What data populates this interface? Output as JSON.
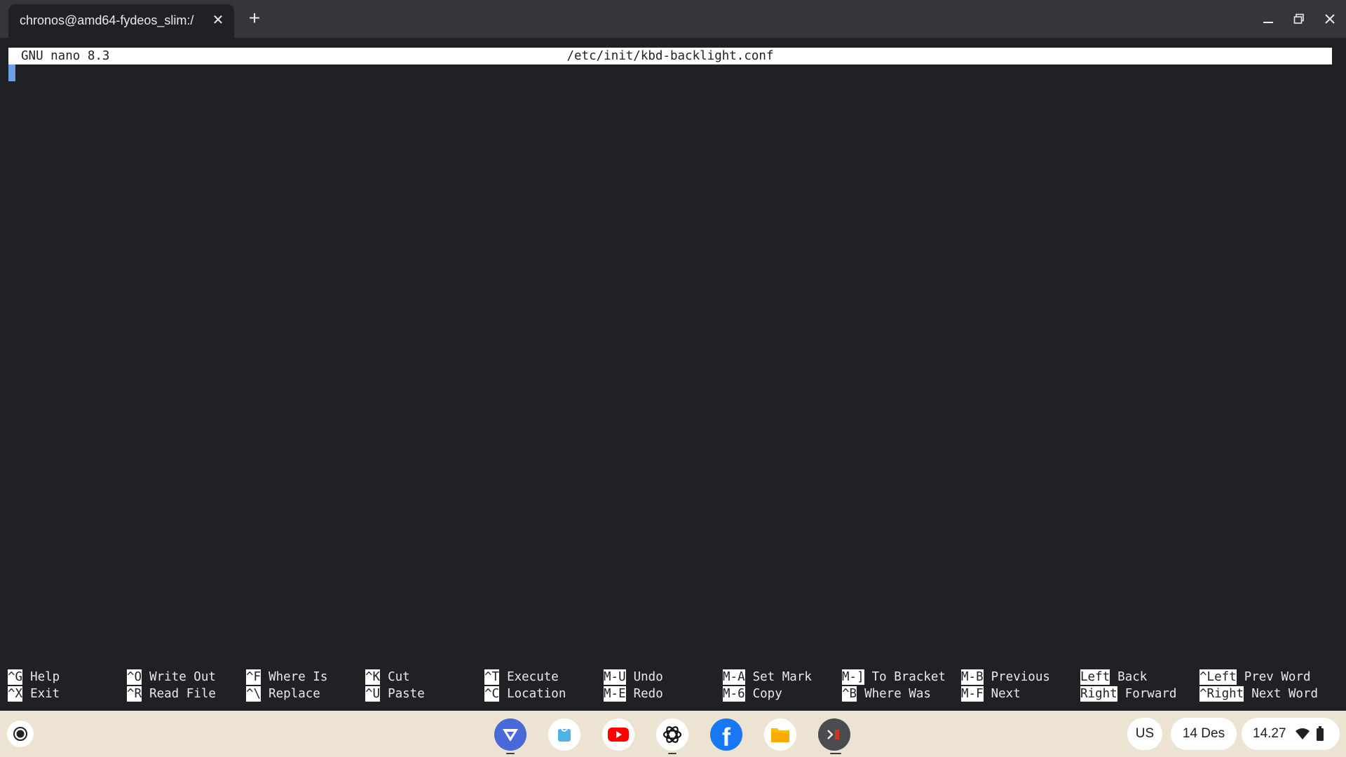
{
  "tab": {
    "title": "chronos@amd64-fydeos_slim:/",
    "close": "✕"
  },
  "new_tab": "+",
  "nano": {
    "version": "GNU nano 8.3",
    "filename": "/etc/init/kbd-backlight.conf",
    "shortcuts_row1": [
      {
        "key": "^G",
        "label": "Help"
      },
      {
        "key": "^O",
        "label": "Write Out"
      },
      {
        "key": "^F",
        "label": "Where Is"
      },
      {
        "key": "^K",
        "label": "Cut"
      },
      {
        "key": "^T",
        "label": "Execute"
      },
      {
        "key": "M-U",
        "label": "Undo"
      },
      {
        "key": "M-A",
        "label": "Set Mark"
      },
      {
        "key": "M-]",
        "label": "To Bracket"
      },
      {
        "key": "M-B",
        "label": "Previous"
      },
      {
        "key": "Left",
        "label": "Back"
      },
      {
        "key": "^Left",
        "label": "Prev Word"
      }
    ],
    "shortcuts_row2": [
      {
        "key": "^X",
        "label": "Exit"
      },
      {
        "key": "^R",
        "label": "Read File"
      },
      {
        "key": "^\\",
        "label": "Replace"
      },
      {
        "key": "^U",
        "label": "Paste"
      },
      {
        "key": "^C",
        "label": "Location"
      },
      {
        "key": "M-E",
        "label": "Redo"
      },
      {
        "key": "M-6",
        "label": "Copy"
      },
      {
        "key": "^B",
        "label": "Where Was"
      },
      {
        "key": "M-F",
        "label": "Next"
      },
      {
        "key": "Right",
        "label": "Forward"
      },
      {
        "key": "^Right",
        "label": "Next Word"
      }
    ]
  },
  "shelf": {
    "apps": [
      {
        "name": "fydeos-app-icon"
      },
      {
        "name": "files-store-icon"
      },
      {
        "name": "youtube-icon"
      },
      {
        "name": "chatgpt-icon"
      },
      {
        "name": "facebook-icon"
      },
      {
        "name": "files-icon"
      },
      {
        "name": "terminal-icon"
      }
    ],
    "ime": "US",
    "date": "14 Des",
    "time": "14.27"
  },
  "colors": {
    "terminal_bg": "#202124",
    "titlebar_bg": "#35363a",
    "shelf_bg": "#ece3d3",
    "cursor": "#6d9eea"
  }
}
